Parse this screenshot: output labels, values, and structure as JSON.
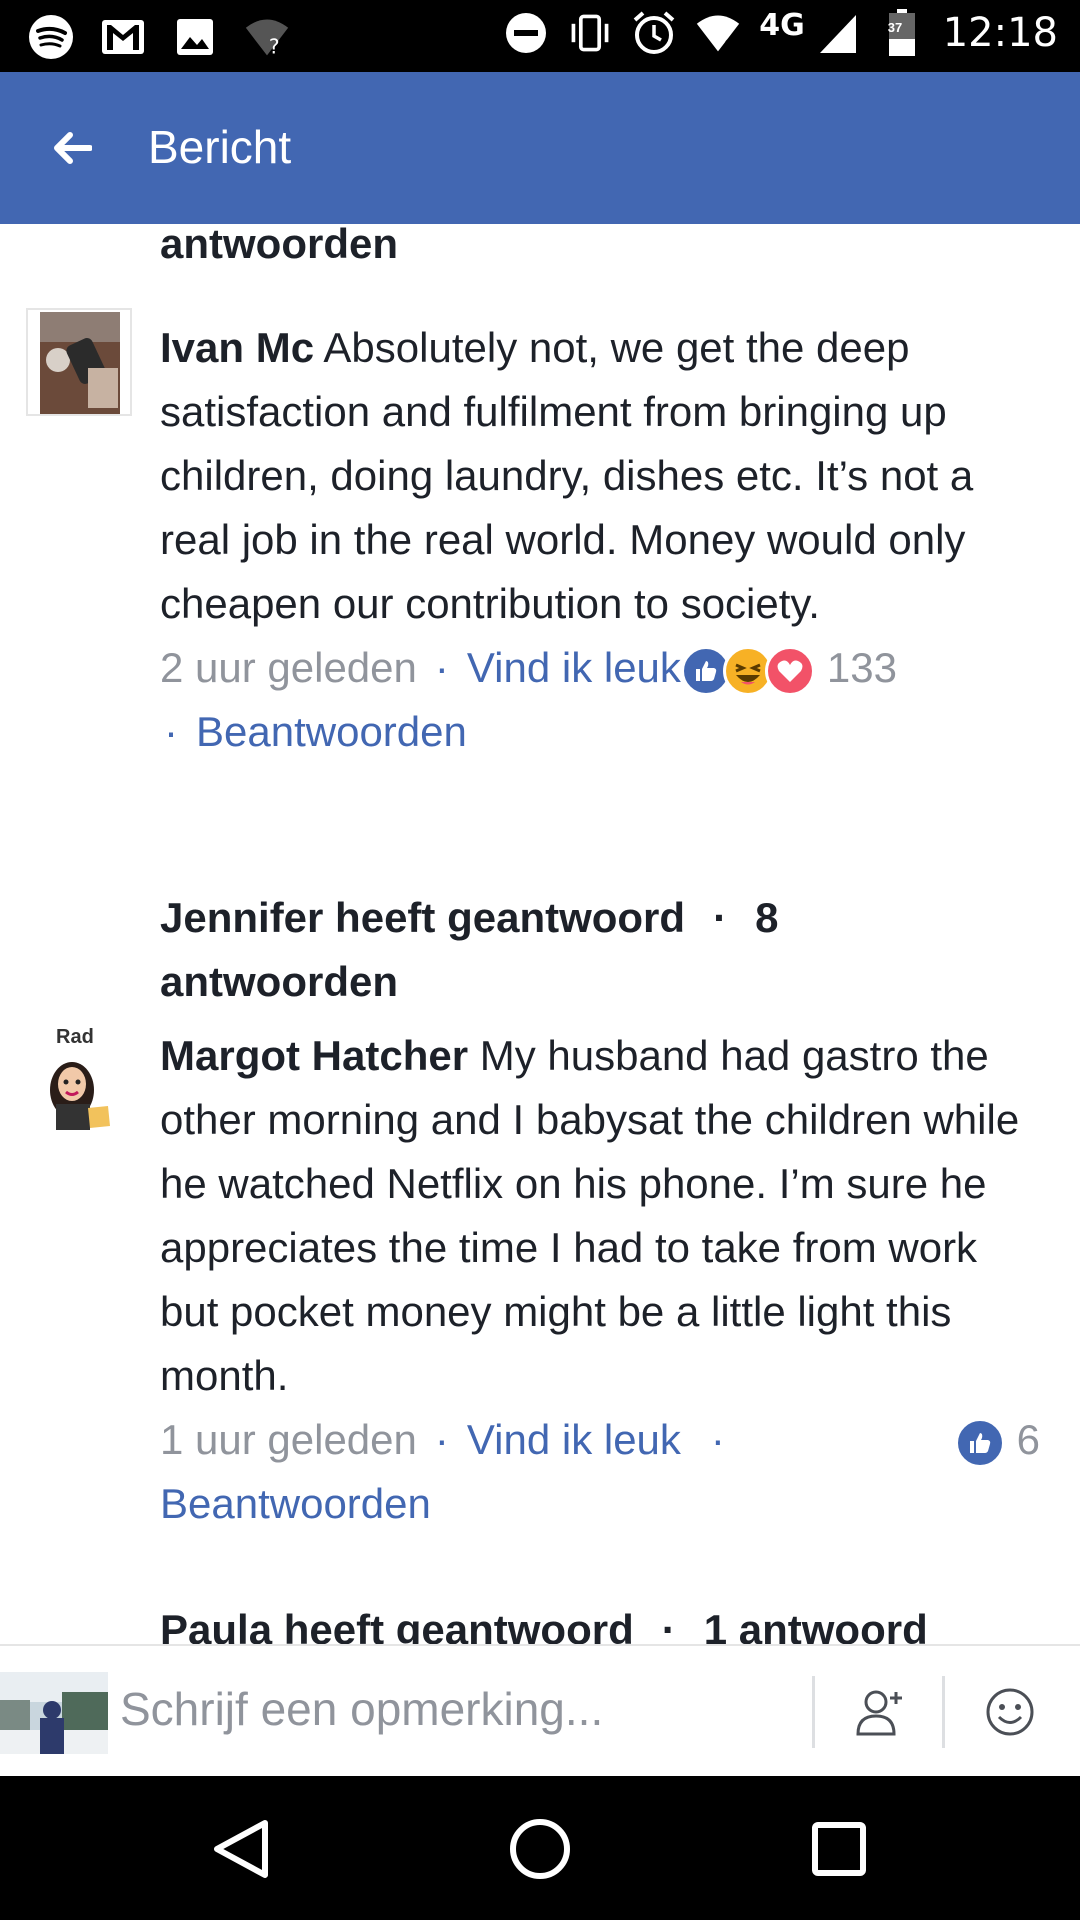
{
  "status_bar": {
    "network": "4G",
    "battery": "37",
    "time": "12:18"
  },
  "app_bar": {
    "title": "Bericht"
  },
  "top_fragment": "antwoorden",
  "comments": [
    {
      "author": "Ivan Mc",
      "text": "Absolutely not, we get the deep satisfaction and fulfilment from bringing up children, doing laundry, dishes etc. It’s not a real job in the real world. Money would only cheapen our contribution to society.",
      "time": "2 uur geleden",
      "like_label": "Vind ik leuk",
      "reply_label": "Beantwoorden",
      "reaction_icons": [
        "like-reaction-icon",
        "haha-reaction-icon",
        "love-reaction-icon"
      ],
      "reaction_count": "133"
    },
    {
      "author": "Margot Hatcher",
      "avatar_caption": "Rad",
      "text": "My husband had gastro the other morning and I babysat the children while he watched Netflix on his phone. I’m sure he appreciates the time I had to take from work but pocket money might be a little light this month.",
      "time": "1 uur geleden",
      "like_label": "Vind ik leuk",
      "reply_label": "Beantwoorden",
      "reaction_icons": [
        "like-reaction-icon"
      ],
      "reaction_count": "6"
    }
  ],
  "reply_threads": [
    {
      "who": "Jennifer heeft geantwoord",
      "count": "8",
      "count_label": "antwoorden"
    },
    {
      "who": "Paula heeft geantwoord",
      "count": "1",
      "count_label": "antwoord"
    }
  ],
  "composer": {
    "placeholder": "Schrijf een opmerking..."
  },
  "colors": {
    "brand": "#4267b2",
    "text": "#1d2129",
    "meta": "#90949c",
    "love": "#f25268",
    "haha": "#f7b125"
  }
}
